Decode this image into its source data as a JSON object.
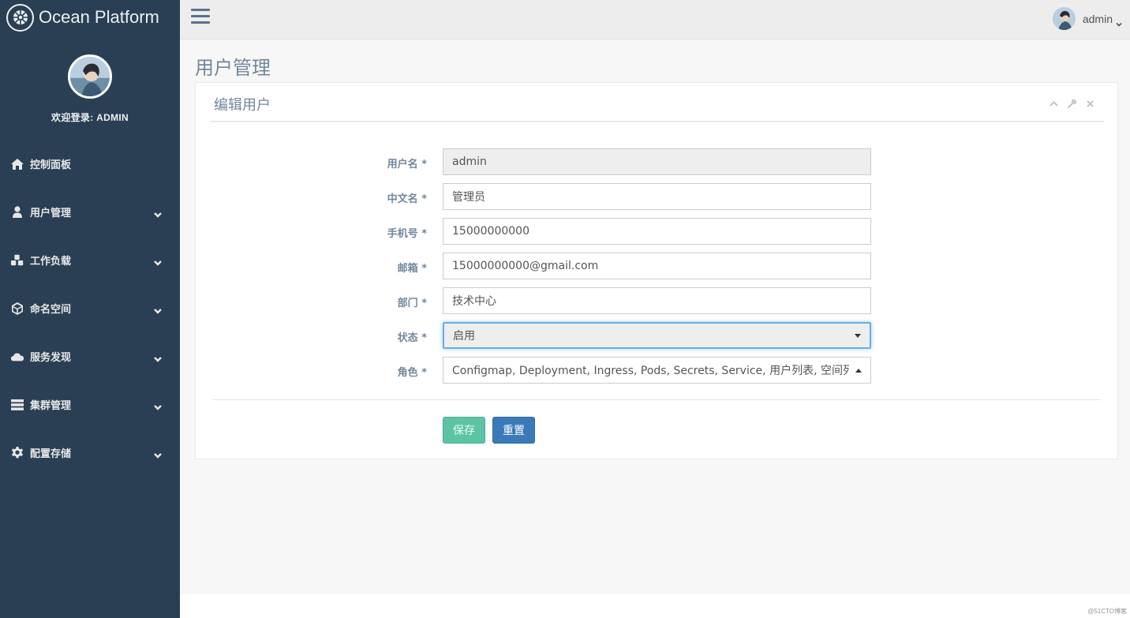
{
  "brand": {
    "title": "Ocean Platform"
  },
  "profile": {
    "welcome": "欢迎登录: ADMIN"
  },
  "sidebar": {
    "items": [
      {
        "label": "控制面板",
        "icon": "home-icon",
        "has_children": false
      },
      {
        "label": "用户管理",
        "icon": "user-icon",
        "has_children": true
      },
      {
        "label": "工作负载",
        "icon": "cubes-icon",
        "has_children": true
      },
      {
        "label": "命名空间",
        "icon": "cube-icon",
        "has_children": true
      },
      {
        "label": "服务发现",
        "icon": "cloud-icon",
        "has_children": true
      },
      {
        "label": "集群管理",
        "icon": "server-icon",
        "has_children": true
      },
      {
        "label": "配置存储",
        "icon": "gear-icon",
        "has_children": true
      }
    ]
  },
  "topbar": {
    "username": "admin"
  },
  "page": {
    "title": "用户管理"
  },
  "panel": {
    "title": "编辑用户",
    "form": {
      "username": {
        "label": "用户名 *",
        "value": "admin"
      },
      "chinese_name": {
        "label": "中文名 *",
        "value": "管理员"
      },
      "phone": {
        "label": "手机号 *",
        "value": "15000000000"
      },
      "email": {
        "label": "邮箱 *",
        "value": "15000000000@gmail.com"
      },
      "department": {
        "label": "部门 *",
        "value": "技术中心"
      },
      "status": {
        "label": "状态 *",
        "value": "启用"
      },
      "role": {
        "label": "角色 *",
        "value": "Configmap, Deployment, Ingress, Pods, Secrets, Service, 用户列表, 空间列表, 节"
      }
    },
    "buttons": {
      "save": "保存",
      "reset": "重置"
    }
  },
  "watermark": "@51CTO博客",
  "colors": {
    "sidebar_bg": "#2a3f54",
    "save_button": "#5cc4a4",
    "reset_button": "#3a7ab8",
    "focus_border": "#66afe9"
  }
}
